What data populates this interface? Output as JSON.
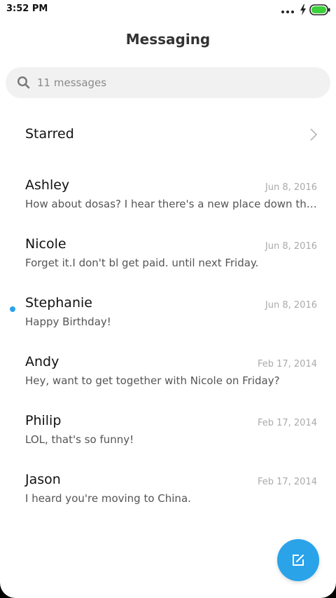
{
  "status_bar": {
    "time": "3:52 PM",
    "icons": [
      "more-dots-icon",
      "charging-bolt-icon",
      "battery-icon"
    ],
    "battery_color": "#3ad13a"
  },
  "header": {
    "title": "Messaging"
  },
  "search": {
    "icon": "search-icon",
    "placeholder": "11 messages"
  },
  "starred": {
    "label": "Starred",
    "icon": "chevron-right-icon"
  },
  "conversations": [
    {
      "name": "Ashley",
      "date": "Jun 8, 2016",
      "preview": "How about dosas? I hear there's a new place down the street",
      "unread": false
    },
    {
      "name": "Nicole",
      "date": "Jun 8, 2016",
      "preview": "Forget it.I don't bl get paid. until next Friday.",
      "unread": false
    },
    {
      "name": "Stephanie",
      "date": "Jun 8, 2016",
      "preview": "Happy Birthday!",
      "unread": true
    },
    {
      "name": "Andy",
      "date": "Feb 17, 2014",
      "preview": "Hey, want to get together with Nicole on Friday?",
      "unread": false
    },
    {
      "name": "Philip",
      "date": "Feb 17, 2014",
      "preview": "LOL, that's so funny!",
      "unread": false
    },
    {
      "name": "Jason",
      "date": "Feb 17, 2014",
      "preview": "I heard you're moving to China.",
      "unread": false
    }
  ],
  "compose": {
    "icon": "compose-icon"
  },
  "colors": {
    "accent": "#2aa3e9",
    "background": "#ffffff",
    "search_background": "#f1f1f1"
  }
}
